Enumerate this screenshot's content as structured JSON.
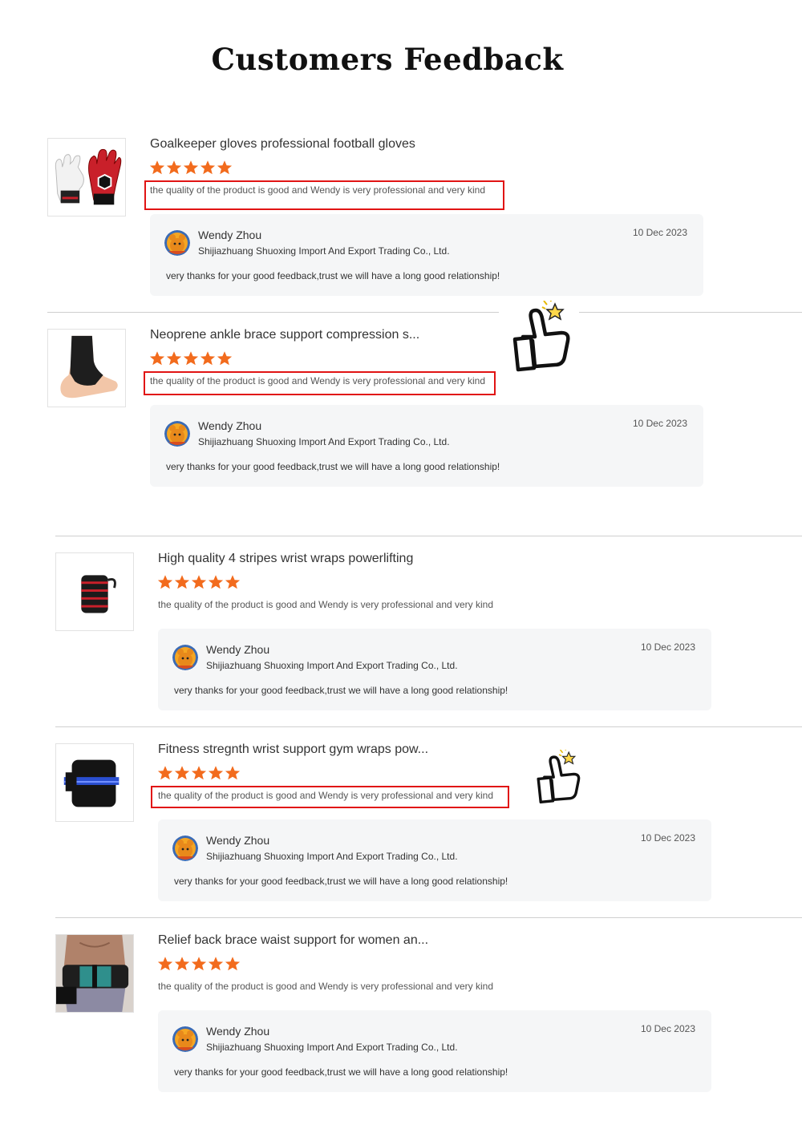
{
  "page": {
    "title": "Customers Feedback"
  },
  "colors": {
    "star": "#f26b1d",
    "highlight": "#e11414",
    "reply_bg": "#f5f6f7"
  },
  "icons": {
    "rating": "star-icon",
    "thumbs": "thumbs-up-icon",
    "avatar": "avatar-icon"
  },
  "reviews": [
    {
      "product_title": "Goalkeeper gloves professional football gloves",
      "rating": 5,
      "review_text": "the quality of the product is good and Wendy is very professional and very kind",
      "highlighted": true,
      "image": "goalkeeper-gloves",
      "reply": {
        "name": "Wendy Zhou",
        "company": "Shijiazhuang Shuoxing Import And Export Trading Co., Ltd.",
        "date": "10 Dec 2023",
        "text": "very thanks for your good feedback,trust we will have a long good relationship!"
      }
    },
    {
      "product_title": "Neoprene ankle brace support compression s...",
      "rating": 5,
      "review_text": "the quality of the product is good and Wendy is very professional and very kind",
      "highlighted": true,
      "image": "ankle-brace",
      "reply": {
        "name": "Wendy Zhou",
        "company": "Shijiazhuang Shuoxing Import And Export Trading Co., Ltd.",
        "date": "10 Dec 2023",
        "text": "very thanks for your good feedback,trust we will have a long good relationship!"
      }
    },
    {
      "product_title": "High quality 4 stripes wrist wraps powerlifting",
      "rating": 5,
      "review_text": "the quality of the product is good and Wendy is very professional and very kind",
      "highlighted": false,
      "image": "wrist-wraps",
      "reply": {
        "name": "Wendy Zhou",
        "company": "Shijiazhuang Shuoxing Import And Export Trading Co., Ltd.",
        "date": "10 Dec 2023",
        "text": "very thanks for your good feedback,trust we will have a long good relationship!"
      }
    },
    {
      "product_title": "Fitness stregnth wrist support gym wraps pow...",
      "rating": 5,
      "review_text": "the quality of the product is good and Wendy is very professional and very kind",
      "highlighted": true,
      "image": "wrist-support",
      "reply": {
        "name": "Wendy Zhou",
        "company": "Shijiazhuang Shuoxing Import And Export Trading Co., Ltd.",
        "date": "10 Dec 2023",
        "text": "very thanks for your good feedback,trust we will have a long good relationship!"
      }
    },
    {
      "product_title": "Relief back brace waist support for women an...",
      "rating": 5,
      "review_text": "the quality of the product is good and Wendy is very professional and very kind",
      "highlighted": false,
      "image": "back-brace",
      "reply": {
        "name": "Wendy Zhou",
        "company": "Shijiazhuang Shuoxing Import And Export Trading Co., Ltd.",
        "date": "10 Dec 2023",
        "text": "very thanks for your good feedback,trust we will have a long good relationship!"
      }
    }
  ]
}
